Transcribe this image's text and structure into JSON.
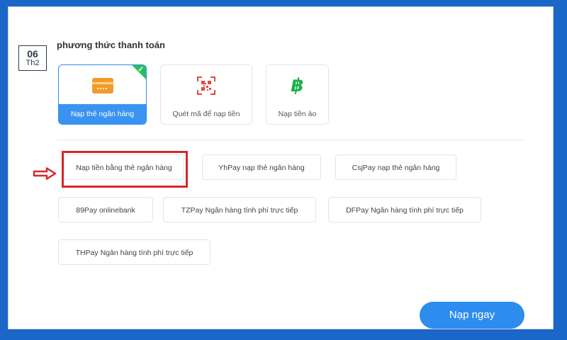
{
  "date_badge": {
    "day": "06",
    "month": "Th2"
  },
  "section_title": "phương thức thanh toán",
  "methods": [
    {
      "label": "Nạp thẻ ngân hàng",
      "icon": "bank-card-icon",
      "selected": true
    },
    {
      "label": "Quét mã để nạp tiền",
      "icon": "qr-code-icon",
      "selected": false
    },
    {
      "label": "Nạp tiền ảo",
      "icon": "bitcoin-icon",
      "selected": false
    }
  ],
  "options": [
    "Nạp tiền bằng thẻ ngân hàng",
    "YhPay nạp thẻ ngân hàng",
    "CsjPay nạp thẻ ngân hàng",
    "89Pay onlinebank",
    "TZPay Ngân hàng tính phí trực tiếp",
    "DFPay Ngân hàng tính phí trực tiếp",
    "THPay Ngân hàng tính phí trực tiếp"
  ],
  "submit_label": "Nạp ngay",
  "colors": {
    "background": "#1a66c9",
    "accent": "#2d8cf0",
    "selected_check": "#28c05f",
    "highlight": "#d9262c"
  }
}
